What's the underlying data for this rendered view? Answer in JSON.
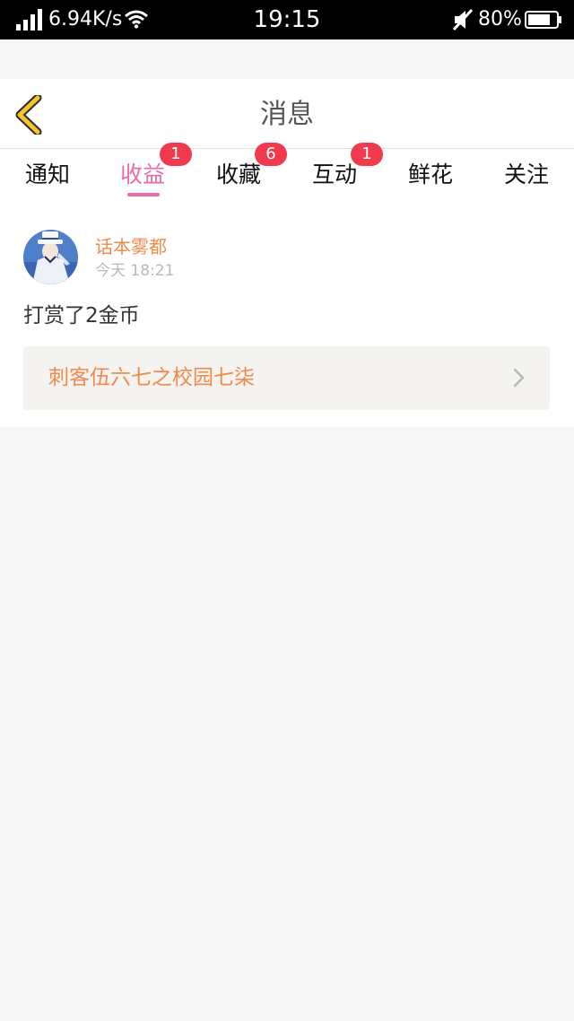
{
  "status_bar": {
    "network_speed": "6.94K/s",
    "time": "19:15",
    "battery_percent": "80%",
    "battery_level": 0.8,
    "icons": [
      "signal-icon",
      "wifi-icon",
      "mute-icon",
      "battery-icon"
    ]
  },
  "header": {
    "title": "消息",
    "back_icon": "chevron-left-icon"
  },
  "tabs": [
    {
      "label": "通知",
      "badge": "",
      "active": false
    },
    {
      "label": "收益",
      "badge": "1",
      "active": true
    },
    {
      "label": "收藏",
      "badge": "6",
      "active": false
    },
    {
      "label": "互动",
      "badge": "1",
      "active": false
    },
    {
      "label": "鲜花",
      "badge": "",
      "active": false
    },
    {
      "label": "关注",
      "badge": "",
      "active": false
    }
  ],
  "message": {
    "username": "话本雾都",
    "time": "今天 18:21",
    "text": "打赏了2金币",
    "book_title": "刺客伍六七之校园七柒",
    "link_icon": "chevron-right-icon"
  },
  "colors": {
    "accent": "#e96ca6",
    "badge": "#f03a4e",
    "username": "#ef8a4d",
    "back_icon": "#f3c331"
  }
}
